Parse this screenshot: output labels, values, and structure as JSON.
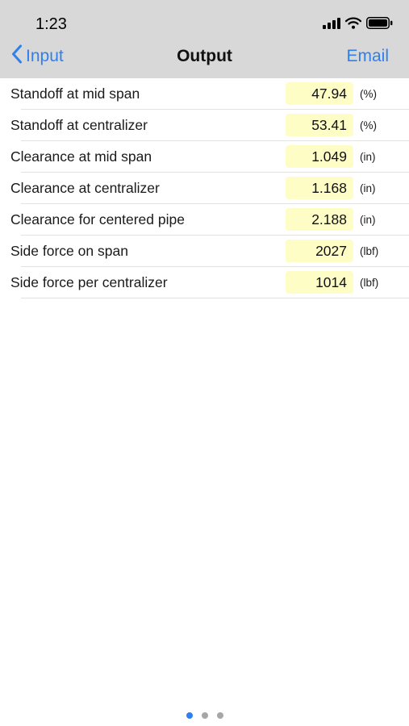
{
  "status_bar": {
    "time": "1:23",
    "icons": [
      "cellular-signal-icon",
      "wifi-icon",
      "battery-icon"
    ]
  },
  "nav_bar": {
    "back_label": "Input",
    "title": "Output",
    "action_label": "Email"
  },
  "rows": [
    {
      "label": "Standoff at mid span",
      "value": "47.94",
      "unit": "(%)"
    },
    {
      "label": "Standoff at centralizer",
      "value": "53.41",
      "unit": "(%)"
    },
    {
      "label": "Clearance at mid span",
      "value": "1.049",
      "unit": "(in)"
    },
    {
      "label": "Clearance at centralizer",
      "value": "1.168",
      "unit": "(in)"
    },
    {
      "label": "Clearance for centered pipe",
      "value": "2.188",
      "unit": "(in)"
    },
    {
      "label": "Side force on span",
      "value": "2027",
      "unit": "(lbf)"
    },
    {
      "label": "Side force per centralizer",
      "value": "1014",
      "unit": "(lbf)"
    }
  ],
  "page_indicator": {
    "count": 3,
    "current": 1
  },
  "colors": {
    "accent": "#2f80ed",
    "header_background": "#d8d8d8",
    "value_background": "#fefdc6"
  }
}
